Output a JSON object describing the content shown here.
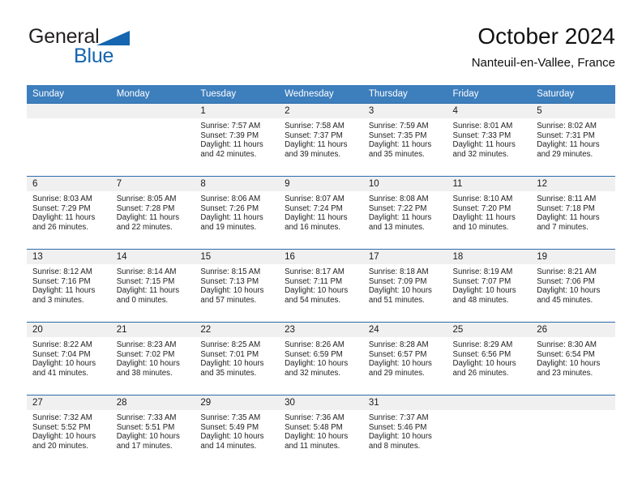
{
  "brand": {
    "line1": "General",
    "line2": "Blue",
    "triangle_color": "#1565b0"
  },
  "header": {
    "title": "October 2024",
    "subtitle": "Nanteuil-en-Vallee, France"
  },
  "theme": {
    "header_blue": "#3d7ebd",
    "divider_blue": "#2b6cab",
    "daynum_band": "#f0f0f0"
  },
  "weekdays": [
    "Sunday",
    "Monday",
    "Tuesday",
    "Wednesday",
    "Thursday",
    "Friday",
    "Saturday"
  ],
  "weeks": [
    [
      {
        "day": "",
        "empty": true
      },
      {
        "day": "",
        "empty": true
      },
      {
        "day": "1",
        "sunrise": "Sunrise: 7:57 AM",
        "sunset": "Sunset: 7:39 PM",
        "daylight1": "Daylight: 11 hours",
        "daylight2": "and 42 minutes."
      },
      {
        "day": "2",
        "sunrise": "Sunrise: 7:58 AM",
        "sunset": "Sunset: 7:37 PM",
        "daylight1": "Daylight: 11 hours",
        "daylight2": "and 39 minutes."
      },
      {
        "day": "3",
        "sunrise": "Sunrise: 7:59 AM",
        "sunset": "Sunset: 7:35 PM",
        "daylight1": "Daylight: 11 hours",
        "daylight2": "and 35 minutes."
      },
      {
        "day": "4",
        "sunrise": "Sunrise: 8:01 AM",
        "sunset": "Sunset: 7:33 PM",
        "daylight1": "Daylight: 11 hours",
        "daylight2": "and 32 minutes."
      },
      {
        "day": "5",
        "sunrise": "Sunrise: 8:02 AM",
        "sunset": "Sunset: 7:31 PM",
        "daylight1": "Daylight: 11 hours",
        "daylight2": "and 29 minutes."
      }
    ],
    [
      {
        "day": "6",
        "sunrise": "Sunrise: 8:03 AM",
        "sunset": "Sunset: 7:29 PM",
        "daylight1": "Daylight: 11 hours",
        "daylight2": "and 26 minutes."
      },
      {
        "day": "7",
        "sunrise": "Sunrise: 8:05 AM",
        "sunset": "Sunset: 7:28 PM",
        "daylight1": "Daylight: 11 hours",
        "daylight2": "and 22 minutes."
      },
      {
        "day": "8",
        "sunrise": "Sunrise: 8:06 AM",
        "sunset": "Sunset: 7:26 PM",
        "daylight1": "Daylight: 11 hours",
        "daylight2": "and 19 minutes."
      },
      {
        "day": "9",
        "sunrise": "Sunrise: 8:07 AM",
        "sunset": "Sunset: 7:24 PM",
        "daylight1": "Daylight: 11 hours",
        "daylight2": "and 16 minutes."
      },
      {
        "day": "10",
        "sunrise": "Sunrise: 8:08 AM",
        "sunset": "Sunset: 7:22 PM",
        "daylight1": "Daylight: 11 hours",
        "daylight2": "and 13 minutes."
      },
      {
        "day": "11",
        "sunrise": "Sunrise: 8:10 AM",
        "sunset": "Sunset: 7:20 PM",
        "daylight1": "Daylight: 11 hours",
        "daylight2": "and 10 minutes."
      },
      {
        "day": "12",
        "sunrise": "Sunrise: 8:11 AM",
        "sunset": "Sunset: 7:18 PM",
        "daylight1": "Daylight: 11 hours",
        "daylight2": "and 7 minutes."
      }
    ],
    [
      {
        "day": "13",
        "sunrise": "Sunrise: 8:12 AM",
        "sunset": "Sunset: 7:16 PM",
        "daylight1": "Daylight: 11 hours",
        "daylight2": "and 3 minutes."
      },
      {
        "day": "14",
        "sunrise": "Sunrise: 8:14 AM",
        "sunset": "Sunset: 7:15 PM",
        "daylight1": "Daylight: 11 hours",
        "daylight2": "and 0 minutes."
      },
      {
        "day": "15",
        "sunrise": "Sunrise: 8:15 AM",
        "sunset": "Sunset: 7:13 PM",
        "daylight1": "Daylight: 10 hours",
        "daylight2": "and 57 minutes."
      },
      {
        "day": "16",
        "sunrise": "Sunrise: 8:17 AM",
        "sunset": "Sunset: 7:11 PM",
        "daylight1": "Daylight: 10 hours",
        "daylight2": "and 54 minutes."
      },
      {
        "day": "17",
        "sunrise": "Sunrise: 8:18 AM",
        "sunset": "Sunset: 7:09 PM",
        "daylight1": "Daylight: 10 hours",
        "daylight2": "and 51 minutes."
      },
      {
        "day": "18",
        "sunrise": "Sunrise: 8:19 AM",
        "sunset": "Sunset: 7:07 PM",
        "daylight1": "Daylight: 10 hours",
        "daylight2": "and 48 minutes."
      },
      {
        "day": "19",
        "sunrise": "Sunrise: 8:21 AM",
        "sunset": "Sunset: 7:06 PM",
        "daylight1": "Daylight: 10 hours",
        "daylight2": "and 45 minutes."
      }
    ],
    [
      {
        "day": "20",
        "sunrise": "Sunrise: 8:22 AM",
        "sunset": "Sunset: 7:04 PM",
        "daylight1": "Daylight: 10 hours",
        "daylight2": "and 41 minutes."
      },
      {
        "day": "21",
        "sunrise": "Sunrise: 8:23 AM",
        "sunset": "Sunset: 7:02 PM",
        "daylight1": "Daylight: 10 hours",
        "daylight2": "and 38 minutes."
      },
      {
        "day": "22",
        "sunrise": "Sunrise: 8:25 AM",
        "sunset": "Sunset: 7:01 PM",
        "daylight1": "Daylight: 10 hours",
        "daylight2": "and 35 minutes."
      },
      {
        "day": "23",
        "sunrise": "Sunrise: 8:26 AM",
        "sunset": "Sunset: 6:59 PM",
        "daylight1": "Daylight: 10 hours",
        "daylight2": "and 32 minutes."
      },
      {
        "day": "24",
        "sunrise": "Sunrise: 8:28 AM",
        "sunset": "Sunset: 6:57 PM",
        "daylight1": "Daylight: 10 hours",
        "daylight2": "and 29 minutes."
      },
      {
        "day": "25",
        "sunrise": "Sunrise: 8:29 AM",
        "sunset": "Sunset: 6:56 PM",
        "daylight1": "Daylight: 10 hours",
        "daylight2": "and 26 minutes."
      },
      {
        "day": "26",
        "sunrise": "Sunrise: 8:30 AM",
        "sunset": "Sunset: 6:54 PM",
        "daylight1": "Daylight: 10 hours",
        "daylight2": "and 23 minutes."
      }
    ],
    [
      {
        "day": "27",
        "sunrise": "Sunrise: 7:32 AM",
        "sunset": "Sunset: 5:52 PM",
        "daylight1": "Daylight: 10 hours",
        "daylight2": "and 20 minutes."
      },
      {
        "day": "28",
        "sunrise": "Sunrise: 7:33 AM",
        "sunset": "Sunset: 5:51 PM",
        "daylight1": "Daylight: 10 hours",
        "daylight2": "and 17 minutes."
      },
      {
        "day": "29",
        "sunrise": "Sunrise: 7:35 AM",
        "sunset": "Sunset: 5:49 PM",
        "daylight1": "Daylight: 10 hours",
        "daylight2": "and 14 minutes."
      },
      {
        "day": "30",
        "sunrise": "Sunrise: 7:36 AM",
        "sunset": "Sunset: 5:48 PM",
        "daylight1": "Daylight: 10 hours",
        "daylight2": "and 11 minutes."
      },
      {
        "day": "31",
        "sunrise": "Sunrise: 7:37 AM",
        "sunset": "Sunset: 5:46 PM",
        "daylight1": "Daylight: 10 hours",
        "daylight2": "and 8 minutes."
      },
      {
        "day": "",
        "empty": true
      },
      {
        "day": "",
        "empty": true
      }
    ]
  ]
}
